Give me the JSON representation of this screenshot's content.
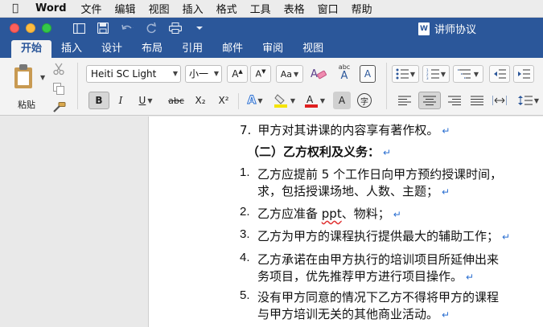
{
  "menubar": {
    "apple_icon": "apple-logo-icon",
    "app_name": "Word",
    "items": [
      "文件",
      "编辑",
      "视图",
      "插入",
      "格式",
      "工具",
      "表格",
      "窗口",
      "帮助"
    ]
  },
  "titlebar": {
    "doc_title": "讲师协议",
    "doc_icon_letter": "W"
  },
  "ribbon_tabs": [
    "开始",
    "插入",
    "设计",
    "布局",
    "引用",
    "邮件",
    "审阅",
    "视图"
  ],
  "ribbon": {
    "paste_label": "粘贴",
    "font_name": "Heiti SC Light",
    "font_size": "小一",
    "bold": "B",
    "italic": "I",
    "underline": "U",
    "strikethrough": "abc",
    "subscript": "X₂",
    "superscript": "X²",
    "grow_font": "A▲",
    "shrink_font": "A▼",
    "change_case": "Aa",
    "phonetic": "abc",
    "phonetic_sub": "A",
    "char_border": "A",
    "char_shading": "A",
    "enclose": "字",
    "text_effects": "A",
    "highlight_color": "#f5e400",
    "font_color": "#e02020"
  },
  "document": {
    "lines": [
      {
        "num": "7.",
        "text": "甲方对其讲课的内容享有著作权。"
      },
      {
        "num": "",
        "text": "（二）乙方权利及义务："
      },
      {
        "num": "1.",
        "text": "乙方应提前  5  个工作日向甲方预约授课时间，"
      },
      {
        "num": "",
        "text": "求，包括授课场地、人数、主题；"
      },
      {
        "num": "2.",
        "text_before": "乙方应准备 ",
        "text_squiggle": "ppt",
        "text_after": "、物料；"
      },
      {
        "num": "3.",
        "text": "乙方为甲方的课程执行提供最大的辅助工作；"
      },
      {
        "num": "4.",
        "text": "乙方承诺在由甲方执行的培训项目所延伸出来"
      },
      {
        "num": "",
        "text": "务项目，优先推荐甲方进行项目操作。"
      },
      {
        "num": "5.",
        "text": "没有甲方同意的情况下乙方不得将甲方的课程"
      },
      {
        "num": "",
        "text": "与甲方培训无关的其他商业活动。"
      }
    ],
    "paragraph_mark": "↵"
  }
}
